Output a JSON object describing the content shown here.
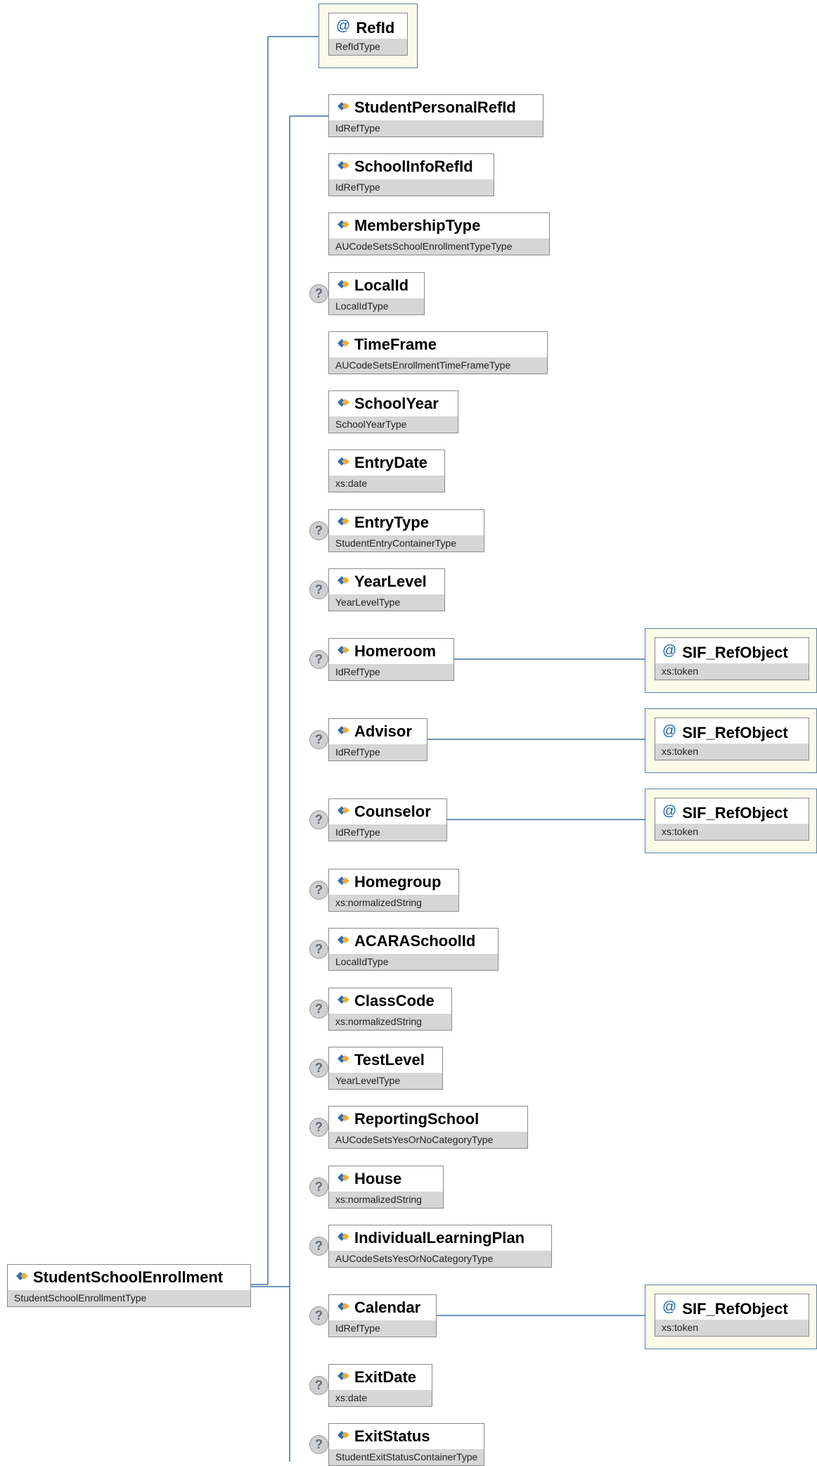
{
  "root": {
    "name": "StudentSchoolEnrollment",
    "type": "StudentSchoolEnrollmentType"
  },
  "attribute": {
    "name": "RefId",
    "type": "RefIdType"
  },
  "ref_attribute": {
    "name": "SIF_RefObject",
    "type": "xs:token"
  },
  "optional_marker": "?",
  "elements": [
    {
      "name": "StudentPersonalRefId",
      "type": "IdRefType"
    },
    {
      "name": "SchoolInfoRefId",
      "type": "IdRefType"
    },
    {
      "name": "MembershipType",
      "type": "AUCodeSetsSchoolEnrollmentTypeType"
    },
    {
      "name": "LocalId",
      "type": "LocalIdType"
    },
    {
      "name": "TimeFrame",
      "type": "AUCodeSetsEnrollmentTimeFrameType"
    },
    {
      "name": "SchoolYear",
      "type": "SchoolYearType"
    },
    {
      "name": "EntryDate",
      "type": "xs:date"
    },
    {
      "name": "EntryType",
      "type": "StudentEntryContainerType"
    },
    {
      "name": "YearLevel",
      "type": "YearLevelType"
    },
    {
      "name": "Homeroom",
      "type": "IdRefType"
    },
    {
      "name": "Advisor",
      "type": "IdRefType"
    },
    {
      "name": "Counselor",
      "type": "IdRefType"
    },
    {
      "name": "Homegroup",
      "type": "xs:normalizedString"
    },
    {
      "name": "ACARASchoolId",
      "type": "LocalIdType"
    },
    {
      "name": "ClassCode",
      "type": "xs:normalizedString"
    },
    {
      "name": "TestLevel",
      "type": "YearLevelType"
    },
    {
      "name": "ReportingSchool",
      "type": "AUCodeSetsYesOrNoCategoryType"
    },
    {
      "name": "House",
      "type": "xs:normalizedString"
    },
    {
      "name": "IndividualLearningPlan",
      "type": "AUCodeSetsYesOrNoCategoryType"
    },
    {
      "name": "Calendar",
      "type": "IdRefType"
    },
    {
      "name": "ExitDate",
      "type": "xs:date"
    },
    {
      "name": "ExitStatus",
      "type": "StudentExitStatusContainerType"
    }
  ],
  "colors": {
    "connector": "#3a6ea5",
    "attribute_frame": "#fbfbe9",
    "type_band": "#d6d6d6"
  }
}
